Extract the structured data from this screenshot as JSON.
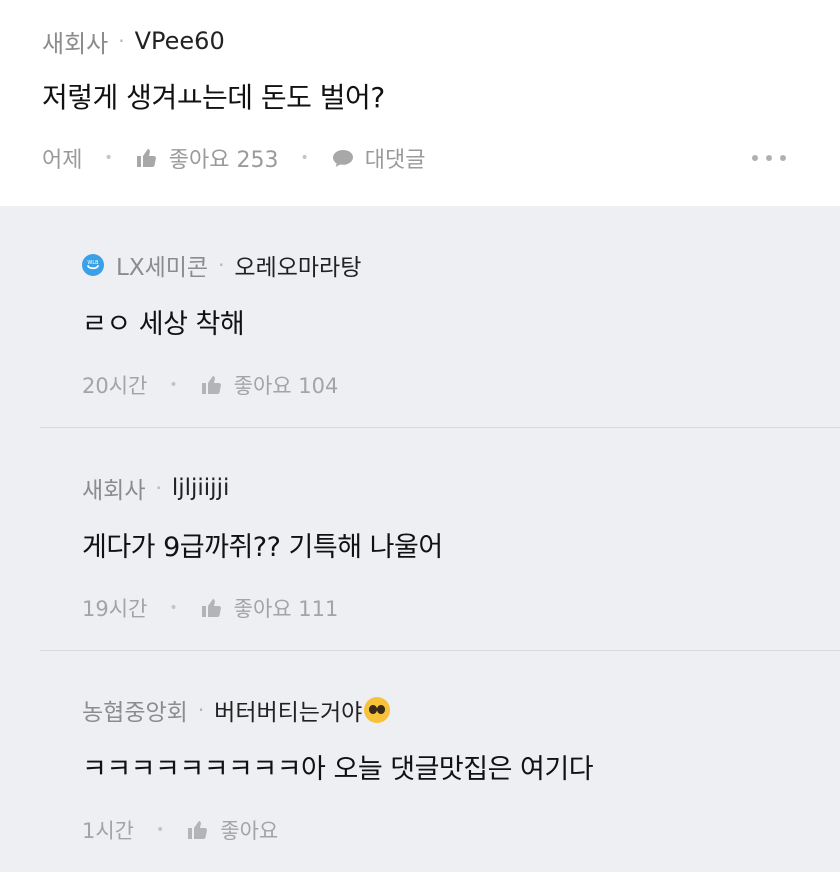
{
  "comment": {
    "company": "새회사",
    "nickname": "VPee60",
    "text": "저렇게 생겨ㅛ는데 돈도 벌어?",
    "time": "어제",
    "like_label": "좋아요 253",
    "reply_label": "대댓글"
  },
  "replies": [
    {
      "company": "LX세미콘",
      "nickname": "오레오마라탕",
      "text": "ㄹㅇ 세상 착해",
      "time": "20시간",
      "like_label": "좋아요 104"
    },
    {
      "company": "새회사",
      "nickname": "ljljiijji",
      "text": "게다가 9급까쥐?? 기특해 나울어",
      "time": "19시간",
      "like_label": "좋아요 111"
    },
    {
      "company": "농협중앙회",
      "nickname": "버터버티는거야",
      "text": "ㅋㅋㅋㅋㅋㅋㅋㅋㅋ아 오늘 댓글맛집은 여기다",
      "time": "1시간",
      "like_label": "좋아요"
    }
  ],
  "icons": {
    "like": "thumbs-up-icon",
    "reply": "speech-bubble-icon",
    "more": "more-dots-icon",
    "verified": "company-badge-icon",
    "emoji": "pleading-face-emoji"
  },
  "colors": {
    "reply_background": "#eeeff3",
    "muted_text": "#9a9a9a",
    "badge": "#3aa0e8"
  }
}
